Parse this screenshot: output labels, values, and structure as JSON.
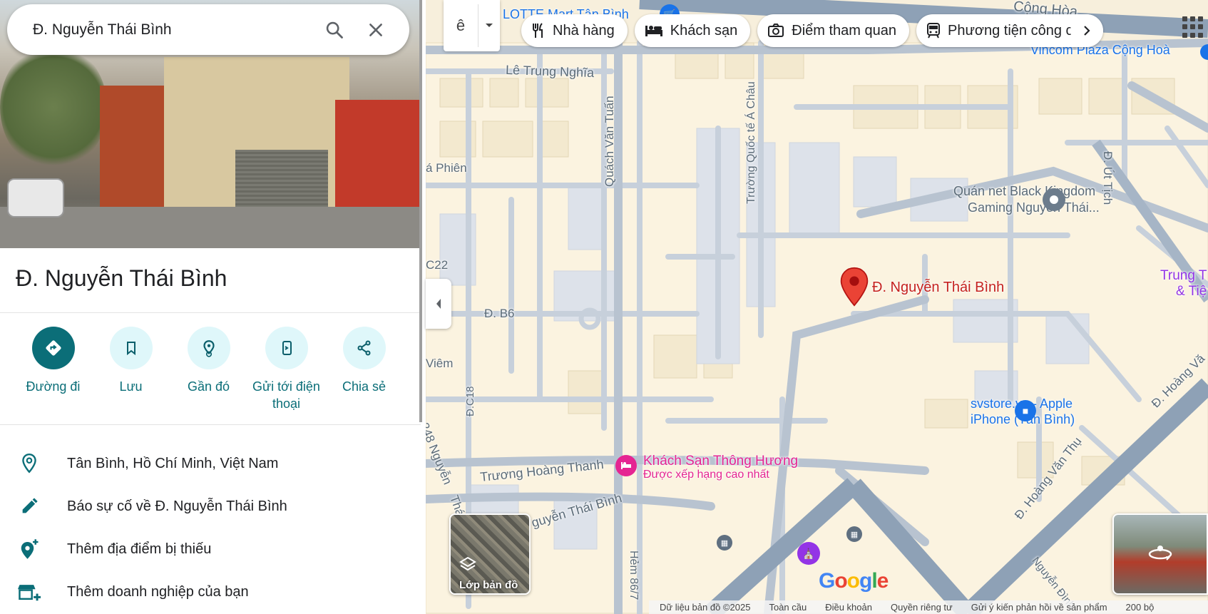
{
  "search": {
    "query": "Đ. Nguyễn Thái Bình"
  },
  "place": {
    "title": "Đ. Nguyễn Thái Bình"
  },
  "actions": [
    {
      "label": "Đường đi",
      "icon": "directions-icon"
    },
    {
      "label": "Lưu",
      "icon": "bookmark-icon"
    },
    {
      "label": "Gần đó",
      "icon": "nearby-icon"
    },
    {
      "label": "Gửi tới điện thoại",
      "icon": "send-to-phone-icon"
    },
    {
      "label": "Chia sẻ",
      "icon": "share-icon"
    }
  ],
  "info_rows": [
    {
      "text": "Tân Bình, Hồ Chí Minh, Việt Nam",
      "icon": "location-pin-icon"
    },
    {
      "text": "Báo sự cố về Đ. Nguyễn Thái Bình",
      "icon": "edit-pencil-icon"
    },
    {
      "text": "Thêm địa điểm bị thiếu",
      "icon": "add-place-icon"
    },
    {
      "text": "Thêm doanh nghiệp của bạn",
      "icon": "add-business-icon"
    }
  ],
  "input_tool": {
    "glyph": "ê"
  },
  "chips": [
    {
      "label": "Nhà hàng",
      "icon": "restaurant-icon"
    },
    {
      "label": "Khách sạn",
      "icon": "hotel-icon"
    },
    {
      "label": "Điểm tham quan",
      "icon": "camera-icon"
    },
    {
      "label": "Phương tiện công cộng",
      "icon": "transit-icon"
    }
  ],
  "map": {
    "pin_label": "Đ. Nguyễn Thái Bình",
    "streets": {
      "cong_hoa": "Cộng Hòa",
      "le_trung_nghia": "Lê Trung Nghĩa",
      "quach_van_tuan": "Quách Văn Tuấn",
      "truong_quoc_te_a_chau": "Trường Quốc tế Á Châu",
      "a_phien": "á Phiên",
      "c22": "C22",
      "b6": "Đ. B6",
      "viem": "Viêm",
      "c18": "Đ.C18",
      "n248": "248 Nguyễn",
      "tha": "Thá",
      "truong_hoang_thanh": "Trương Hoàng Thanh",
      "nguyen_thai_binh": "guyễn Thái Bình",
      "hem86": "Hẻm 86/7",
      "ut_tich": "Đ. Út Tịch",
      "hoang_van_thu": "Đ. Hoàng Văn Thụ",
      "hoang_right": "Đ. Hoàng Vă",
      "nguyen_dinh": "Nguyễn Đình",
      "lotte": "LOTTE Mart Tân Bình"
    },
    "pois": {
      "vincom": "Vincom Plaza Cộng Hoà",
      "quan_net_1": "Quán net Black Kingdom",
      "quan_net_2": "Gaming Nguyễn Thái...",
      "svstore_1": "svstore.vn - Apple",
      "svstore_2": "iPhone (Tân Bình)",
      "hotel_1": "Khách Sạn Thông Hương",
      "hotel_2": "Được xếp hạng cao nhất",
      "trung_1": "Trung T",
      "trung_2": "& Tiệ"
    },
    "layers_label": "Lớp bản đồ",
    "google_letters": [
      "G",
      "o",
      "o",
      "g",
      "l",
      "e"
    ],
    "google_colors": [
      "#4285F4",
      "#EA4335",
      "#FBBC05",
      "#4285F4",
      "#34A853",
      "#EA4335"
    ]
  },
  "footer": {
    "data": "Dữ liệu bản đồ ©2025",
    "global": "Toàn cầu",
    "terms": "Điều khoản",
    "privacy": "Quyền riêng tư",
    "feedback": "Gửi ý kiến phản hồi về sản phẩm",
    "scale": "200 bộ"
  },
  "colors": {
    "accent": "#0b6e78",
    "pin": "#ea4335",
    "hotel": "#e52592",
    "poi_blue": "#1a73e8"
  }
}
